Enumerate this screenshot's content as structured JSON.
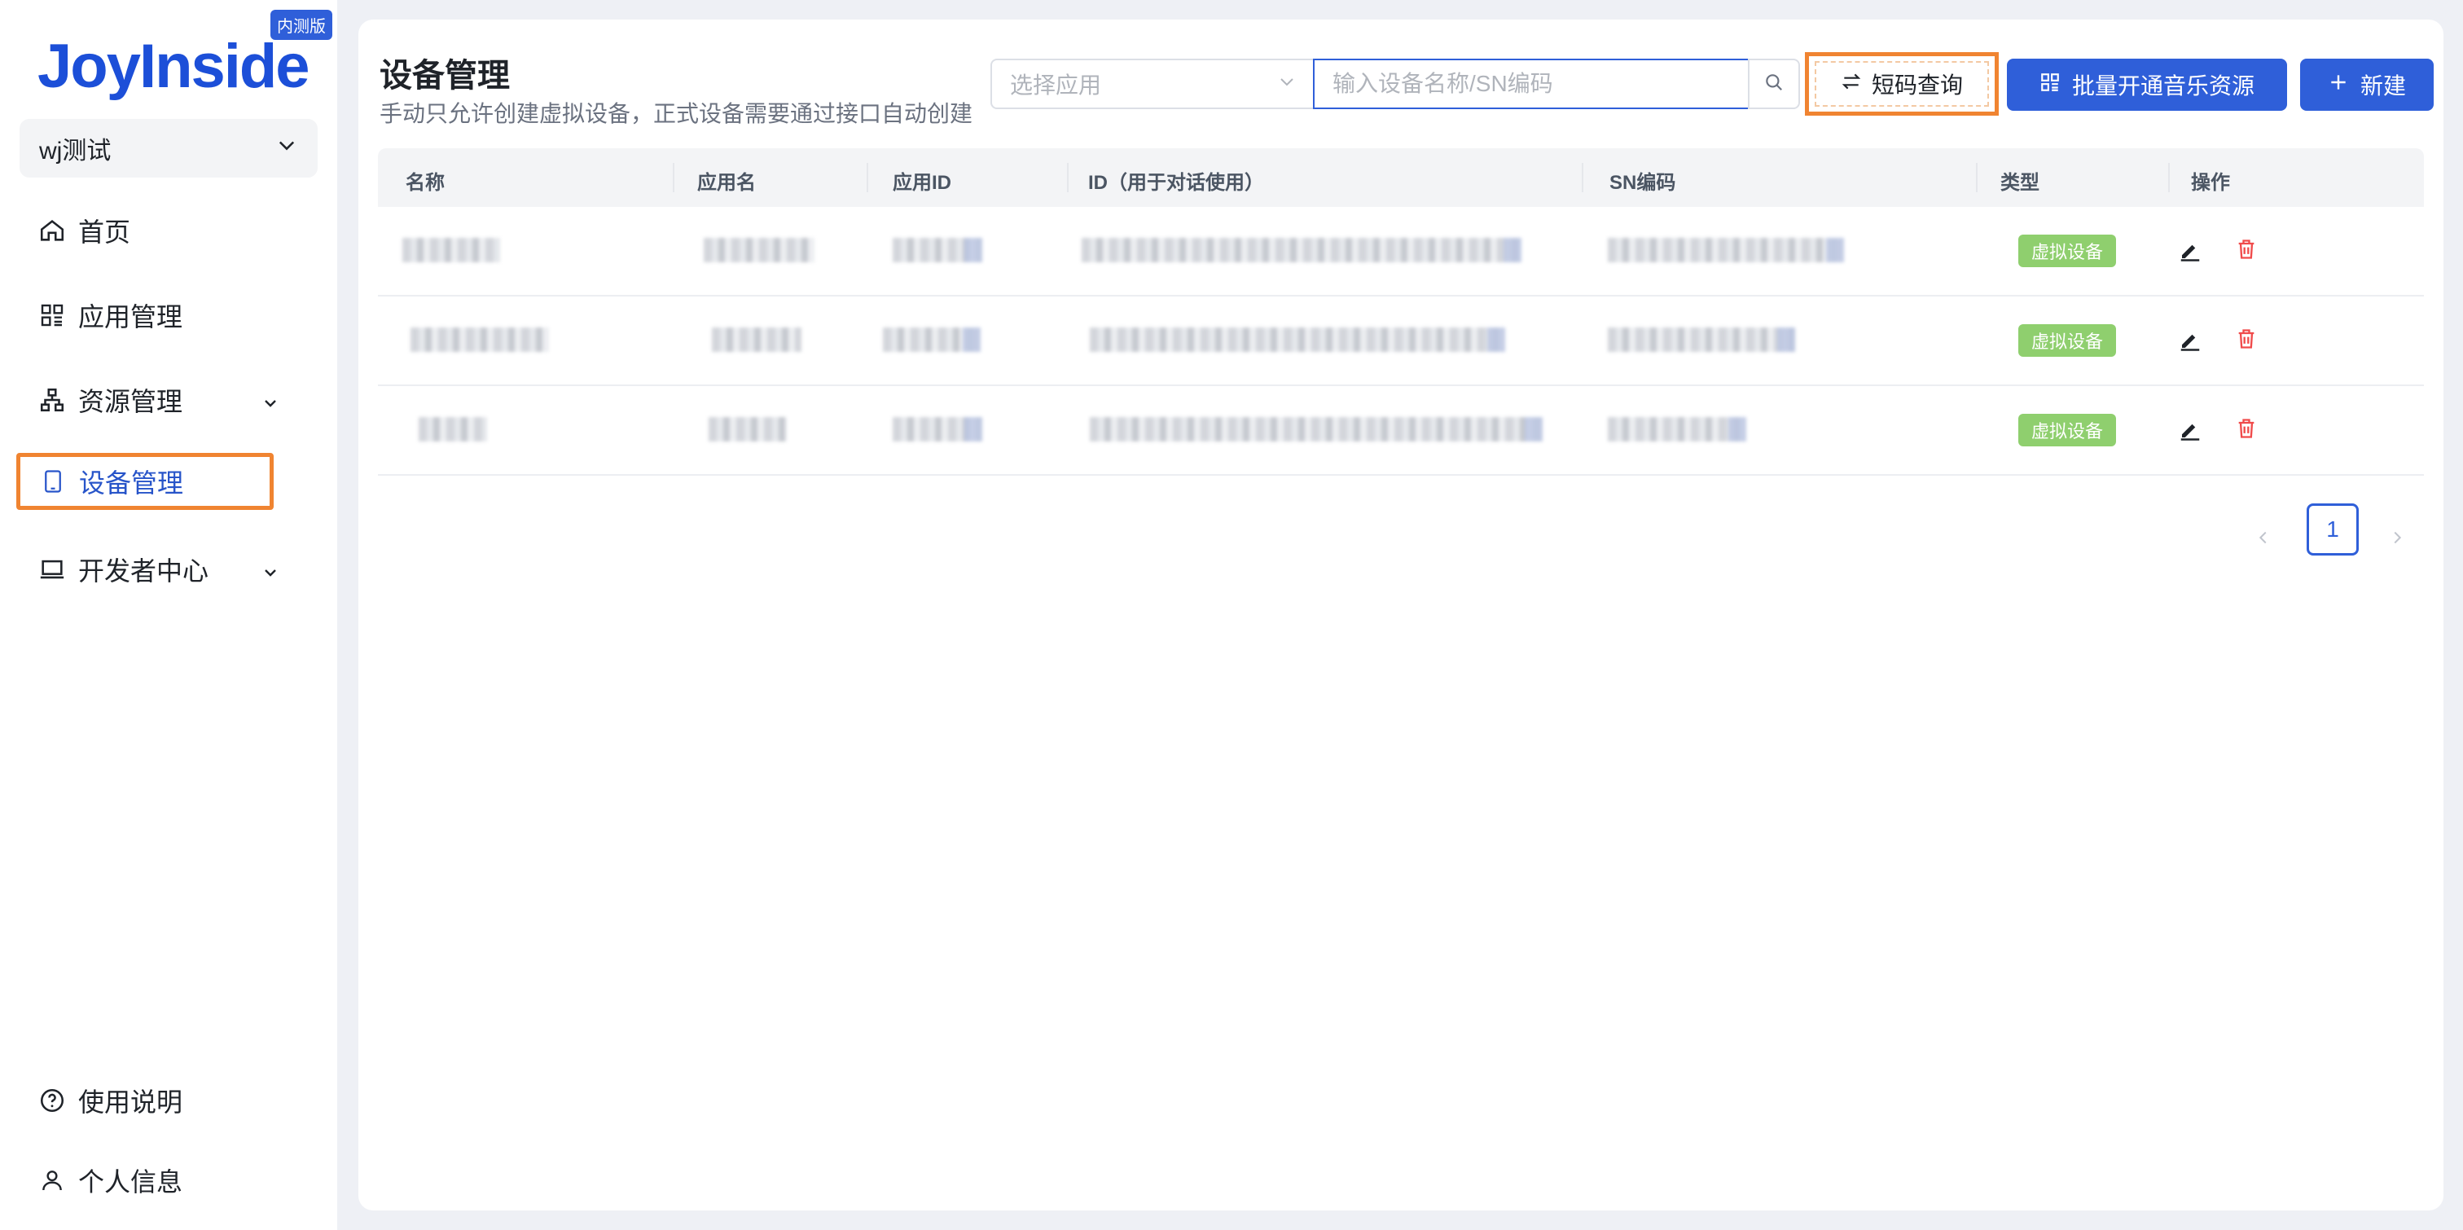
{
  "brand": {
    "logo": "JoyInside",
    "badge": "内测版"
  },
  "app_selector": {
    "value": "wj测试"
  },
  "sidebar": {
    "items": [
      {
        "label": "首页"
      },
      {
        "label": "应用管理"
      },
      {
        "label": "资源管理"
      },
      {
        "label": "设备管理"
      },
      {
        "label": "开发者中心"
      }
    ],
    "footer": [
      {
        "label": "使用说明"
      },
      {
        "label": "个人信息"
      }
    ]
  },
  "page": {
    "title": "设备管理",
    "subtitle": "手动只允许创建虚拟设备，正式设备需要通过接口自动创建"
  },
  "toolbar": {
    "select_placeholder": "选择应用",
    "search_placeholder": "输入设备名称/SN编码",
    "short_code_label": "短码查询",
    "batch_music_label": "批量开通音乐资源",
    "new_label": "新建"
  },
  "table": {
    "columns": [
      "名称",
      "应用名",
      "应用ID",
      "ID（用于对话使用）",
      "SN编码",
      "类型",
      "操作"
    ],
    "rows": [
      {
        "type": "虚拟设备"
      },
      {
        "type": "虚拟设备"
      },
      {
        "type": "虚拟设备"
      }
    ]
  },
  "pagination": {
    "current": "1"
  },
  "colors": {
    "primary": "#2f5fd9",
    "highlight": "#f08431",
    "tag_green": "#8fcf6e",
    "danger": "#f04b4b"
  }
}
